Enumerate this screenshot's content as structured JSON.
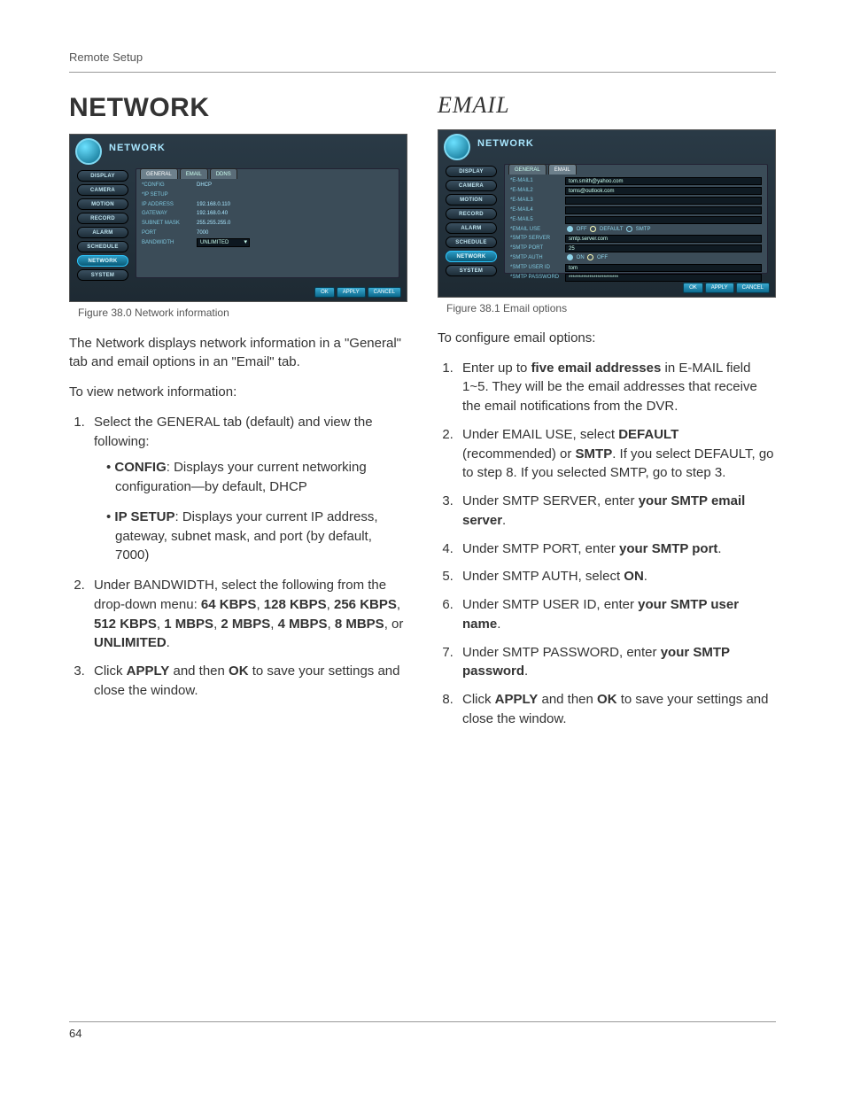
{
  "page": {
    "header": "Remote Setup",
    "number": "64"
  },
  "left": {
    "title": "NETWORK",
    "shot": {
      "header": "NETWORK",
      "sidebar": [
        "DISPLAY",
        "CAMERA",
        "MOTION",
        "RECORD",
        "ALARM",
        "SCHEDULE",
        "NETWORK",
        "SYSTEM"
      ],
      "active_sidebar": "NETWORK",
      "tabs": [
        "GENERAL",
        "EMAIL",
        "DDNS"
      ],
      "active_tab": "GENERAL",
      "rows": [
        {
          "label": "*CONFIG",
          "val": "DHCP"
        },
        {
          "label": "*IP SETUP",
          "val": ""
        },
        {
          "label": "IP ADDRESS",
          "val": "192.168.0.110"
        },
        {
          "label": "GATEWAY",
          "val": "192.168.0.40"
        },
        {
          "label": "SUBNET MASK",
          "val": "255.255.255.0"
        },
        {
          "label": "PORT",
          "val": "7000"
        },
        {
          "label": "BANDWIDTH",
          "val": "UNLIMITED",
          "select": true
        }
      ],
      "buttons": [
        "OK",
        "APPLY",
        "CANCEL"
      ]
    },
    "caption": "Figure 38.0 Network information",
    "intro": "The Network displays network information in a \"General\" tab and email options in an \"Email\" tab.",
    "lead": "To view network information:",
    "steps": [
      {
        "text_before": "Select the GENERAL tab (default) and view the following:",
        "bullets": [
          {
            "bold": "CONFIG",
            "rest": ": Displays your current networking configuration—by default, DHCP"
          },
          {
            "bold": "IP SETUP",
            "rest": ": Displays your current IP address, gateway, subnet mask, and port (by default, 7000)"
          }
        ]
      },
      {
        "pre": "Under BANDWIDTH, select the following from the drop-down menu: ",
        "opts": [
          "64 KBPS",
          "128 KBPS",
          "256 KBPS",
          "512 KBPS",
          "1 MBPS",
          "2 MBPS",
          "4 MBPS",
          "8 MBPS"
        ],
        "tail_bold": "UNLIMITED",
        "tail_plain": "."
      },
      {
        "click": {
          "a": "Click ",
          "b": "APPLY",
          "c": " and then ",
          "d": "OK",
          "e": " to save your settings and close the window."
        }
      }
    ]
  },
  "right": {
    "title": "EMAIL",
    "shot": {
      "header": "NETWORK",
      "sidebar": [
        "DISPLAY",
        "CAMERA",
        "MOTION",
        "RECORD",
        "ALARM",
        "SCHEDULE",
        "NETWORK",
        "SYSTEM"
      ],
      "active_sidebar": "NETWORK",
      "tabs": [
        "GENERAL",
        "EMAIL"
      ],
      "active_tab": "EMAIL",
      "emails": [
        {
          "label": "*E-MAIL1",
          "val": "tom.smith@yahoo.com"
        },
        {
          "label": "*E-MAIL2",
          "val": "toms@outlook.com"
        },
        {
          "label": "*E-MAIL3",
          "val": ""
        },
        {
          "label": "*E-MAIL4",
          "val": ""
        },
        {
          "label": "*E-MAIL5",
          "val": ""
        }
      ],
      "fields": [
        {
          "label": "*EMAIL USE",
          "radios": [
            "OFF",
            "DEFAULT",
            "SMTP"
          ]
        },
        {
          "label": "*SMTP SERVER",
          "input": "smtp.server.com"
        },
        {
          "label": "*SMTP PORT",
          "input": "25"
        },
        {
          "label": "*SMTP AUTH",
          "radios": [
            "ON",
            "OFF"
          ]
        },
        {
          "label": "*SMTP USER ID",
          "input": "tom"
        },
        {
          "label": "*SMTP PASSWORD",
          "input": "************************"
        }
      ],
      "buttons": [
        "OK",
        "APPLY",
        "CANCEL"
      ]
    },
    "caption": "Figure 38.1 Email options",
    "lead": "To configure email options:",
    "steps": [
      {
        "pre": "Enter up to ",
        "b": "five email addresses",
        "post": " in E-MAIL field 1~5. They will be the email addresses that receive the email notifications from the DVR."
      },
      {
        "pre": "Under EMAIL USE, select ",
        "b": "DEFAULT",
        "mid": " (recommended) or ",
        "b2": "SMTP",
        "post": ". If you select DEFAULT, go to step 8. If you selected SMTP, go to step 3."
      },
      {
        "pre": "Under SMTP SERVER, enter ",
        "b": "your SMTP email server",
        "post": "."
      },
      {
        "pre": "Under SMTP PORT, enter ",
        "b": "your SMTP port",
        "post": "."
      },
      {
        "pre": "Under SMTP AUTH, select ",
        "b": "ON",
        "post": "."
      },
      {
        "pre": "Under SMTP USER ID, enter ",
        "b": "your SMTP user name",
        "post": "."
      },
      {
        "pre": "Under SMTP PASSWORD, enter ",
        "b": "your SMTP password",
        "post": "."
      },
      {
        "click": {
          "a": "Click ",
          "b": "APPLY",
          "c": " and then ",
          "d": "OK",
          "e": " to save your settings and close the window."
        }
      }
    ]
  }
}
